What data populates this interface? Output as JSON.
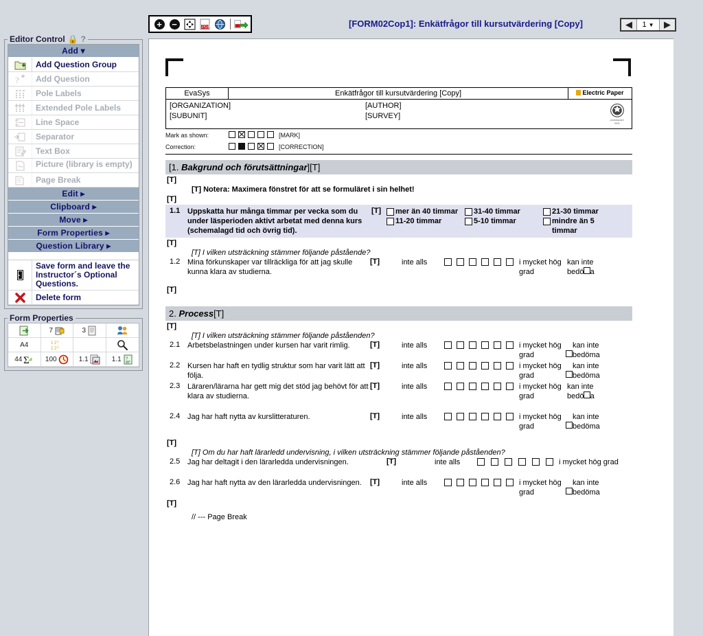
{
  "toolbar": {
    "icons": [
      "zoom-in-icon",
      "zoom-out-icon",
      "fit-page-icon",
      "pdf-icon",
      "pdf-preview-icon",
      "pdf-export-icon"
    ],
    "title": "[FORM02Cop1]: Enkätfrågor till kursutvärdering [Copy]"
  },
  "pager": {
    "page": "1",
    "prev": "◀",
    "next": "▶",
    "caret": "▼"
  },
  "editor_control": {
    "legend": "Editor Control",
    "help": "?",
    "add_bar": "Add",
    "items": [
      {
        "label": "Add Question Group",
        "disabled": false,
        "icon": "add-folder-icon"
      },
      {
        "label": "Add Question",
        "disabled": true,
        "icon": "add-question-icon"
      },
      {
        "label": "Pole Labels",
        "disabled": true,
        "icon": "pole-labels-icon"
      },
      {
        "label": "Extended Pole Labels",
        "disabled": true,
        "icon": "extended-pole-labels-icon"
      },
      {
        "label": "Line Space",
        "disabled": true,
        "icon": "line-space-icon"
      },
      {
        "label": "Separator",
        "disabled": true,
        "icon": "separator-icon"
      },
      {
        "label": "Text Box",
        "disabled": true,
        "icon": "text-box-icon"
      },
      {
        "label": "Picture (library is empty)",
        "disabled": true,
        "icon": "picture-icon"
      },
      {
        "label": "Page Break",
        "disabled": true,
        "icon": "page-break-icon"
      }
    ],
    "bars": [
      "Edit",
      "Clipboard",
      "Move",
      "Form Properties",
      "Question Library"
    ],
    "actions": [
      {
        "label": "Save form and leave the Instructor´s Optional Questions.",
        "icon": "exit-door-icon"
      },
      {
        "label": "Delete form",
        "icon": "delete-red-x-icon"
      }
    ]
  },
  "form_properties": {
    "legend": "Form Properties",
    "cells": [
      {
        "value": "",
        "icon": "export-page-icon"
      },
      {
        "value": "7",
        "icon": "questions-lock-icon"
      },
      {
        "value": "3",
        "icon": "pages-icon"
      },
      {
        "value": "",
        "icon": "users-icon"
      },
      {
        "value": "A4",
        "icon": ""
      },
      {
        "value": "",
        "icon": "numbering-icon"
      },
      {
        "value": "",
        "icon": ""
      },
      {
        "value": "",
        "icon": "search-icon"
      },
      {
        "value": "44",
        "icon": "sigma-icon"
      },
      {
        "value": "100",
        "icon": "clock-icon"
      },
      {
        "value": "1.1",
        "icon": "image-version-icon"
      },
      {
        "value": "1.1",
        "icon": "doc-version-icon"
      }
    ]
  },
  "document": {
    "header": {
      "brand": "EvaSys",
      "title": "Enkätfrågor till kursutvärdering [Copy]",
      "vendor": "Electric Paper",
      "organization": "[ORGANIZATION]",
      "author": "[AUTHOR]",
      "subunit": "[SUBUNIT]",
      "survey": "[SURVEY]"
    },
    "marking": {
      "mark_label": "Mark as shown:",
      "mark_tag": "[MARK]",
      "mark_boxes": [
        "empty",
        "cross",
        "empty",
        "empty",
        "empty"
      ],
      "correction_label": "Correction:",
      "correction_tag": "[CORRECTION]",
      "correction_boxes": [
        "empty",
        "filled",
        "empty",
        "cross",
        "empty"
      ]
    },
    "t_mark": "[T]",
    "sections": [
      {
        "heading_prefix": "[1. ",
        "heading_em": "Bakgrund och förutsättningar",
        "heading_suffix": "][T]",
        "note": "[T] Notera: Maximera fönstret för att se formuläret i sin helhet!",
        "instruction": "[T] I vilken utsträckning stämmer följande påstående?",
        "q11": {
          "num": "1.1",
          "text": "Uppskatta hur många timmar per vecka som du under läsperioden aktivt arbetat med denna kurs (schemalagd tid och övrig tid).",
          "tt": "[T]",
          "options": [
            "mer än 40 timmar",
            "31-40 timmar",
            "21-30 timmar",
            "11-20 timmar",
            "5-10 timmar",
            "mindre än 5 timmar"
          ]
        },
        "q12": {
          "num": "1.2",
          "text": "Mina förkunskaper var tillräckliga för att jag skulle kunna klara av studierna.",
          "tt": "[T]",
          "low": "inte alls",
          "high": "i mycket hög grad",
          "na": "kan inte bedöma",
          "boxes": 6
        }
      },
      {
        "heading_prefix": "2. ",
        "heading_em": "Process",
        "heading_suffix": "[T]",
        "instruction": "[T] I vilken utsträckning stämmer följande påstående",
        "instruction_full": "[T] I vilken utsträckning stämmer följande påståenden?",
        "instruction2": "[T] Om du har haft lärarledd undervisning, i vilken utsträckning stämmer följande påståenden?",
        "questions": [
          {
            "num": "2.1",
            "text": "Arbetsbelastningen under kursen har varit rimlig.",
            "tt": "[T]",
            "low": "inte alls",
            "high": "i mycket hög grad",
            "na": "kan inte bedöma",
            "boxes": 6
          },
          {
            "num": "2.2",
            "text": "Kursen har haft en tydlig struktur som har varit lätt att följa.",
            "tt": "[T]",
            "low": "inte alls",
            "high": "i mycket hög grad",
            "na": "kan inte bedöma",
            "boxes": 6
          },
          {
            "num": "2.3",
            "text": "Läraren/lärarna har gett mig det stöd jag behövt för att klara av studierna.",
            "tt": "[T]",
            "low": "inte alls",
            "high": "i mycket hög grad",
            "na": "kan inte bedöma",
            "boxes": 6
          },
          {
            "num": "2.4",
            "text": "Jag har haft nytta av kurslitteraturen.",
            "tt": "[T]",
            "low": "inte alls",
            "high": "i mycket hög grad",
            "na": "kan inte bedöma",
            "boxes": 6
          }
        ],
        "questions2": [
          {
            "num": "2.5",
            "text": "Jag har deltagit i den lärarledda undervisningen.",
            "tt": "[T]",
            "low": "inte alls",
            "high": "i mycket hög grad",
            "na": "",
            "boxes": 6
          },
          {
            "num": "2.6",
            "text": "Jag har haft nytta av den lärarledda undervisningen.",
            "tt": "[T]",
            "low": "inte alls",
            "high": "i mycket hög grad",
            "na": "kan inte bedöma",
            "boxes": 6
          }
        ],
        "page_break": "// --- Page Break"
      }
    ]
  },
  "colors": {
    "accent_bar": "#9aabbd",
    "title_blue": "#1a1a8c",
    "highlight_row": "#dfe1f0",
    "section_gray": "#c9cdd4",
    "app_bg": "#d4dae0"
  }
}
